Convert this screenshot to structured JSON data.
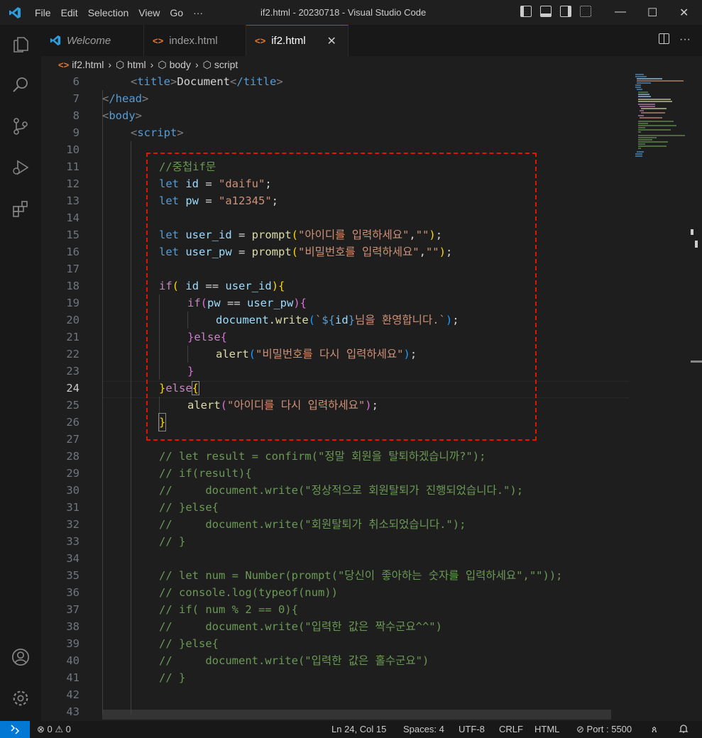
{
  "window": {
    "title": "if2.html - 20230718 - Visual Studio Code",
    "menu": [
      "File",
      "Edit",
      "Selection",
      "View",
      "Go",
      "···"
    ]
  },
  "tabs": [
    {
      "label": "Welcome",
      "icon": "vscode-logo-icon"
    },
    {
      "label": "index.html",
      "icon": "html-file-icon"
    },
    {
      "label": "if2.html",
      "icon": "html-file-icon",
      "active": true
    }
  ],
  "breadcrumb": [
    "if2.html",
    "html",
    "body",
    "script"
  ],
  "editor": {
    "current_line": 24,
    "lines": [
      {
        "n": "6"
      },
      {
        "n": "7"
      },
      {
        "n": "8"
      },
      {
        "n": "9"
      },
      {
        "n": "10"
      },
      {
        "n": "11"
      },
      {
        "n": "12"
      },
      {
        "n": "13"
      },
      {
        "n": "14"
      },
      {
        "n": "15"
      },
      {
        "n": "16"
      },
      {
        "n": "17"
      },
      {
        "n": "18"
      },
      {
        "n": "19"
      },
      {
        "n": "20"
      },
      {
        "n": "21"
      },
      {
        "n": "22"
      },
      {
        "n": "23"
      },
      {
        "n": "24"
      },
      {
        "n": "25"
      },
      {
        "n": "26"
      },
      {
        "n": "27"
      },
      {
        "n": "28"
      },
      {
        "n": "29"
      },
      {
        "n": "30"
      },
      {
        "n": "31"
      },
      {
        "n": "32"
      },
      {
        "n": "33"
      },
      {
        "n": "34"
      },
      {
        "n": "35"
      },
      {
        "n": "36"
      },
      {
        "n": "37"
      },
      {
        "n": "38"
      },
      {
        "n": "39"
      },
      {
        "n": "40"
      },
      {
        "n": "41"
      },
      {
        "n": "42"
      },
      {
        "n": "43"
      }
    ],
    "tokens": {
      "title_open": "title",
      "doc": "Document",
      "title_close": "/title",
      "head_close": "/head",
      "body_open": "body",
      "script_open": "script",
      "l11": "//중첩if문",
      "let": "let",
      "id": "id",
      "pw": "pw",
      "eq": " = ",
      "daifu": "\"daifu\"",
      "a12345": "\"a12345\"",
      "semi": ";",
      "user_id": "user_id",
      "user_pw": "user_pw",
      "prompt": "prompt",
      "s_id": "\"아이디를 입력하세요\"",
      "s_pw": "\"비밀번호를 입력하세요\"",
      "empty": "\"\"",
      "if": "if",
      "else": "else",
      "eqeq": " == ",
      "document": "document",
      "write": "write",
      "tpl_open": "`",
      "tpl_var_open": "${",
      "tpl_var_close": "}",
      "tpl_text": "님을 환영합니다.",
      "tpl_close": "`",
      "alert": "alert",
      "s_pw_again": "\"비밀번호를 다시 입력하세요\"",
      "s_id_again": "\"아이디를 다시 입력하세요\"",
      "c28": "// let result = confirm(\"정말 회원을 탈퇴하겠습니까?\");",
      "c29": "// if(result){",
      "c30": "//     document.write(\"정상적으로 회원탈퇴가 진행되었습니다.\");",
      "c31": "// }else{",
      "c32": "//     document.write(\"회원탈퇴가 취소되었습니다.\");",
      "c33": "// }",
      "c35": "// let num = Number(prompt(\"당신이 좋아하는 숫자를 입력하세요\",\"\"));",
      "c36": "// console.log(typeof(num))",
      "c37": "// if( num % 2 == 0){",
      "c38": "//     document.write(\"입력한 값은 짝수군요^^\")",
      "c39": "// }else{",
      "c40": "//     document.write(\"입력한 값은 홀수군요\")",
      "c41": "// }"
    }
  },
  "statusbar": {
    "errors": "0",
    "warnings": "0",
    "position": "Ln 24, Col 15",
    "spaces": "Spaces: 4",
    "encoding": "UTF-8",
    "eol": "CRLF",
    "language": "HTML",
    "port": "Port : 5500"
  },
  "colors": {
    "accent": "#0078d4",
    "highlight_box": "#e51400"
  }
}
